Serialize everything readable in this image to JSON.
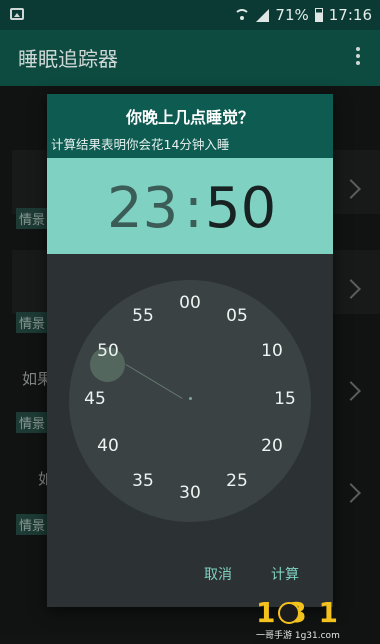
{
  "status_bar": {
    "battery": "71%",
    "time": "17:16"
  },
  "app_bar": {
    "title": "睡眠追踪器"
  },
  "background": {
    "tags": [
      "情景",
      "情景",
      "情景",
      "情景"
    ],
    "texts": [
      "如果",
      "如"
    ]
  },
  "dialog": {
    "title": "你晚上几点睡觉？",
    "subtitle": "计算结果表明你会花14分钟入睡",
    "hour": "23",
    "separator": ":",
    "minute": "50",
    "dial": [
      "00",
      "05",
      "10",
      "15",
      "20",
      "25",
      "30",
      "35",
      "40",
      "45",
      "50",
      "55"
    ],
    "selected_minute": "50",
    "buttons": {
      "cancel": "取消",
      "calculate": "计算"
    }
  },
  "watermark": {
    "text": "1 3 1",
    "url": "一哥手游 1g31.com"
  },
  "colors": {
    "header": "#0d5b51",
    "time_band": "#7fd1c2",
    "accent": "#7fd1c2"
  }
}
